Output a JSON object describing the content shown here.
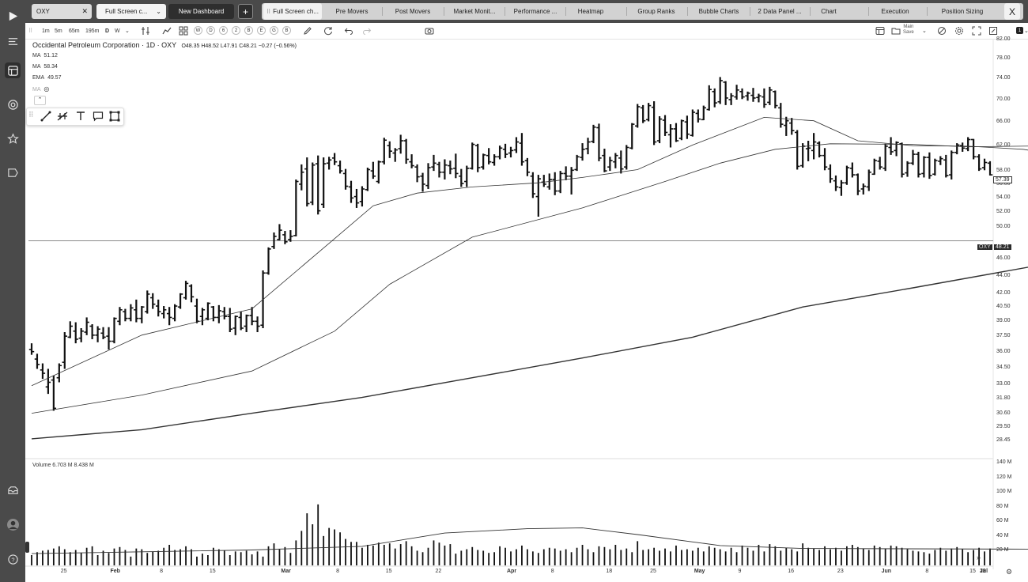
{
  "sidebar": {
    "icons": [
      "play-logo-icon",
      "menu-icon",
      "layout-icon",
      "target-icon",
      "star-icon",
      "screener-icon",
      "inbox-icon",
      "avatar",
      "help-icon"
    ]
  },
  "header": {
    "symbol_input": "OXY",
    "dashboard_tab": "Full Screen c...",
    "new_dashboard": "New Dashboard",
    "add_label": "+",
    "tabs": [
      "Full Screen ch...",
      "Pre Movers",
      "Post Movers",
      "Market Monit...",
      "Performance ...",
      "Heatmap",
      "Group Ranks",
      "Bubble Charts",
      "2 Data Panel ...",
      "Chart",
      "Execution",
      "Position Sizing"
    ],
    "close_label": "X"
  },
  "toolbar": {
    "intervals": [
      "1m",
      "5m",
      "65m",
      "195m",
      "D",
      "W"
    ],
    "circles": [
      "W",
      "D",
      "6",
      "2",
      "B",
      "E",
      "G",
      "B"
    ],
    "main_label": "Main",
    "save_label": "Save",
    "count_badge": "1"
  },
  "chart": {
    "title": "Occidental Petroleum Corporation · 1D · OXY",
    "ohlc": "O48.35  H48.52  L47.91  C48.21  −0.27  (−0.56%)",
    "indicators": [
      {
        "name": "MA",
        "value": "51.12"
      },
      {
        "name": "MA",
        "value": "58.34"
      },
      {
        "name": "EMA",
        "value": "49.57"
      },
      {
        "name": "MA",
        "value": ""
      }
    ],
    "volume_legend": "Volume  6.703 M  8.438 M",
    "price_ticks": [
      "82.00",
      "78.00",
      "74.00",
      "70.00",
      "66.00",
      "62.00",
      "58.00",
      "56.00",
      "54.00",
      "52.00",
      "50.00",
      "46.00",
      "44.00",
      "42.00",
      "40.50",
      "39.00",
      "37.50",
      "36.00",
      "34.50",
      "33.00",
      "31.80",
      "30.60",
      "29.50",
      "28.45"
    ],
    "volume_ticks": [
      "140 M",
      "120 M",
      "100 M",
      "80 M",
      "60 M",
      "40 M",
      "20 M"
    ],
    "time_labels": [
      "25",
      "Feb",
      "8",
      "15",
      "Mar",
      "8",
      "15",
      "22",
      "Apr",
      "8",
      "18",
      "25",
      "May",
      "9",
      "16",
      "23",
      "Jun",
      "8",
      "15",
      "23",
      "Jul",
      "11"
    ],
    "last_price": "57.39",
    "line_symbol": "OXY",
    "line_price": "48.21"
  },
  "chart_data": {
    "type": "ohlc",
    "title": "Occidental Petroleum Corporation · 1D · OXY",
    "y_scale": "log",
    "ylim": [
      28.45,
      82.0
    ],
    "x_range": [
      "Jan 18",
      "Jul 12"
    ],
    "candles": [
      [
        36.2,
        36.8,
        35.7,
        36.0
      ],
      [
        35.3,
        35.8,
        34.4,
        34.8
      ],
      [
        34.3,
        34.9,
        33.5,
        34.0
      ],
      [
        32.8,
        34.4,
        32.2,
        33.2
      ],
      [
        33.4,
        33.8,
        30.8,
        31.0
      ],
      [
        33.6,
        34.9,
        33.2,
        34.7
      ],
      [
        35.0,
        37.9,
        34.4,
        37.5
      ],
      [
        37.4,
        39.0,
        37.3,
        38.5
      ],
      [
        38.0,
        38.9,
        36.8,
        37.2
      ],
      [
        37.3,
        38.3,
        36.9,
        38.0
      ],
      [
        37.9,
        39.4,
        37.6,
        38.9
      ],
      [
        38.5,
        38.7,
        37.2,
        37.6
      ],
      [
        37.6,
        38.5,
        36.9,
        38.2
      ],
      [
        37.8,
        38.4,
        37.2,
        37.4
      ],
      [
        37.5,
        38.4,
        36.2,
        37.0
      ],
      [
        37.0,
        39.4,
        36.8,
        39.3
      ],
      [
        39.0,
        40.5,
        38.6,
        40.2
      ],
      [
        40.0,
        40.3,
        39.0,
        39.3
      ],
      [
        39.3,
        40.8,
        39.0,
        40.4
      ],
      [
        40.2,
        41.3,
        38.9,
        39.3
      ],
      [
        39.3,
        40.6,
        38.8,
        40.5
      ],
      [
        40.0,
        42.3,
        39.8,
        41.9
      ],
      [
        41.5,
        42.0,
        40.3,
        40.8
      ],
      [
        40.6,
        41.3,
        39.5,
        40.0
      ],
      [
        39.8,
        40.6,
        39.3,
        40.2
      ],
      [
        39.8,
        40.5,
        38.6,
        39.4
      ],
      [
        39.3,
        40.8,
        39.0,
        40.6
      ],
      [
        40.5,
        42.0,
        40.3,
        41.9
      ],
      [
        41.5,
        43.4,
        41.3,
        43.1
      ],
      [
        42.8,
        43.0,
        41.0,
        41.6
      ],
      [
        40.6,
        41.4,
        38.8,
        39.0
      ],
      [
        39.5,
        40.4,
        38.6,
        40.2
      ],
      [
        39.3,
        41.0,
        39.1,
        40.9
      ],
      [
        40.5,
        40.6,
        39.0,
        39.4
      ],
      [
        39.4,
        40.7,
        38.8,
        40.1
      ],
      [
        40.0,
        40.5,
        39.2,
        39.5
      ],
      [
        39.5,
        40.4,
        37.9,
        38.2
      ],
      [
        38.3,
        39.6,
        37.6,
        39.5
      ],
      [
        39.4,
        40.0,
        38.1,
        38.3
      ],
      [
        38.5,
        39.7,
        37.9,
        39.6
      ],
      [
        39.6,
        40.5,
        38.6,
        39.0
      ],
      [
        39.0,
        39.5,
        37.9,
        38.5
      ],
      [
        38.6,
        44.6,
        38.3,
        44.3
      ],
      [
        44.3,
        47.4,
        44.1,
        47.2
      ],
      [
        47.5,
        49.3,
        47.2,
        48.8
      ],
      [
        48.4,
        50.4,
        48.3,
        49.6
      ],
      [
        49.0,
        49.5,
        47.8,
        48.1
      ],
      [
        48.4,
        49.6,
        48.1,
        48.8
      ],
      [
        48.9,
        56.7,
        48.8,
        56.4
      ],
      [
        56.0,
        59.0,
        55.1,
        57.8
      ],
      [
        58.3,
        60.1,
        52.8,
        53.2
      ],
      [
        53.4,
        59.3,
        53.0,
        58.9
      ],
      [
        59.1,
        60.4,
        51.7,
        52.2
      ],
      [
        53.1,
        60.1,
        52.6,
        59.1
      ],
      [
        59.2,
        60.2,
        58.2,
        59.7
      ],
      [
        60.0,
        60.8,
        58.9,
        59.4
      ],
      [
        58.8,
        59.6,
        57.6,
        58.0
      ],
      [
        57.6,
        58.3,
        55.2,
        55.7
      ],
      [
        55.6,
        56.5,
        53.3,
        54.0
      ],
      [
        54.2,
        55.3,
        52.6,
        53.3
      ],
      [
        53.5,
        55.7,
        52.8,
        55.3
      ],
      [
        55.2,
        58.5,
        55.0,
        58.2
      ],
      [
        58.0,
        59.4,
        56.8,
        57.2
      ],
      [
        56.4,
        59.6,
        56.1,
        59.4
      ],
      [
        59.4,
        63.3,
        59.0,
        62.9
      ],
      [
        62.0,
        62.7,
        60.0,
        61.1
      ],
      [
        60.8,
        61.6,
        59.4,
        61.3
      ],
      [
        61.5,
        63.8,
        60.7,
        62.8
      ],
      [
        62.8,
        63.1,
        59.1,
        59.8
      ],
      [
        59.4,
        60.6,
        58.4,
        58.8
      ],
      [
        58.6,
        59.0,
        56.3,
        57.1
      ],
      [
        57.2,
        57.7,
        54.9,
        56.0
      ],
      [
        55.8,
        59.2,
        55.3,
        58.5
      ],
      [
        58.6,
        60.5,
        58.0,
        59.2
      ],
      [
        59.0,
        59.4,
        57.0,
        57.8
      ],
      [
        57.8,
        59.8,
        56.7,
        58.9
      ],
      [
        58.8,
        59.6,
        57.5,
        58.3
      ],
      [
        58.4,
        60.7,
        56.9,
        57.6
      ],
      [
        57.2,
        58.3,
        55.6,
        56.1
      ],
      [
        56.4,
        58.8,
        55.6,
        58.4
      ],
      [
        58.4,
        62.5,
        58.2,
        62.2
      ],
      [
        62.0,
        62.3,
        57.8,
        58.5
      ],
      [
        58.6,
        60.7,
        58.2,
        60.5
      ],
      [
        60.4,
        61.6,
        59.0,
        59.4
      ],
      [
        59.3,
        60.6,
        58.8,
        60.2
      ],
      [
        60.2,
        62.0,
        59.8,
        61.6
      ],
      [
        61.4,
        62.3,
        60.0,
        60.6
      ],
      [
        60.8,
        61.8,
        60.1,
        61.2
      ],
      [
        61.3,
        63.4,
        60.8,
        62.6
      ],
      [
        62.4,
        64.1,
        58.8,
        59.4
      ],
      [
        59.6,
        60.0,
        57.2,
        57.8
      ],
      [
        57.2,
        57.8,
        54.0,
        54.6
      ],
      [
        54.2,
        57.4,
        51.4,
        56.8
      ],
      [
        56.3,
        57.4,
        55.6,
        56.0
      ],
      [
        55.6,
        57.6,
        55.2,
        56.7
      ],
      [
        56.7,
        57.8,
        54.4,
        55.0
      ],
      [
        55.0,
        58.0,
        54.7,
        57.6
      ],
      [
        57.6,
        58.7,
        56.6,
        57.2
      ],
      [
        57.2,
        58.6,
        54.5,
        58.1
      ],
      [
        58.2,
        60.5,
        58.0,
        60.2
      ],
      [
        60.1,
        62.4,
        59.6,
        61.4
      ],
      [
        61.5,
        63.3,
        60.6,
        62.6
      ],
      [
        62.7,
        65.5,
        62.4,
        65.1
      ],
      [
        65.0,
        65.7,
        59.5,
        60.0
      ],
      [
        60.4,
        61.5,
        57.8,
        58.0
      ],
      [
        58.6,
        60.2,
        58.0,
        59.6
      ],
      [
        59.4,
        60.8,
        58.4,
        60.4
      ],
      [
        60.0,
        61.2,
        57.6,
        58.3
      ],
      [
        58.6,
        62.1,
        58.2,
        61.7
      ],
      [
        61.6,
        65.8,
        61.4,
        65.6
      ],
      [
        65.3,
        69.2,
        65.0,
        68.7
      ],
      [
        68.5,
        69.0,
        65.8,
        66.2
      ],
      [
        66.4,
        69.4,
        66.1,
        68.9
      ],
      [
        68.6,
        69.7,
        62.1,
        62.6
      ],
      [
        62.8,
        67.0,
        62.4,
        66.5
      ],
      [
        66.3,
        67.2,
        63.6,
        64.2
      ],
      [
        63.8,
        65.6,
        61.7,
        64.8
      ],
      [
        64.8,
        65.8,
        62.6,
        62.8
      ],
      [
        63.2,
        66.4,
        62.9,
        66.2
      ],
      [
        66.0,
        67.1,
        63.1,
        63.9
      ],
      [
        63.7,
        68.2,
        63.5,
        67.7
      ],
      [
        67.5,
        68.2,
        65.9,
        66.5
      ],
      [
        66.4,
        68.9,
        66.3,
        68.5
      ],
      [
        68.2,
        72.7,
        68.0,
        71.9
      ],
      [
        71.5,
        72.1,
        68.6,
        69.4
      ],
      [
        69.6,
        74.3,
        69.2,
        73.6
      ],
      [
        73.3,
        73.5,
        69.0,
        70.3
      ],
      [
        70.0,
        71.2,
        69.0,
        70.7
      ],
      [
        70.5,
        72.8,
        70.0,
        71.8
      ],
      [
        71.5,
        72.1,
        70.1,
        70.5
      ],
      [
        70.7,
        71.5,
        69.8,
        71.2
      ],
      [
        70.8,
        72.2,
        69.6,
        70.3
      ],
      [
        70.4,
        71.1,
        69.5,
        70.7
      ],
      [
        70.5,
        72.1,
        68.5,
        69.1
      ],
      [
        69.5,
        72.4,
        69.0,
        71.8
      ],
      [
        71.5,
        71.7,
        68.4,
        68.9
      ],
      [
        68.5,
        69.4,
        65.0,
        65.6
      ],
      [
        65.4,
        66.9,
        63.6,
        66.2
      ],
      [
        65.8,
        66.7,
        63.8,
        64.5
      ],
      [
        64.2,
        64.6,
        58.2,
        58.7
      ],
      [
        58.8,
        62.4,
        58.5,
        61.9
      ],
      [
        61.5,
        62.8,
        59.5,
        61.6
      ],
      [
        61.2,
        64.1,
        59.8,
        62.6
      ],
      [
        62.4,
        62.7,
        60.1,
        60.4
      ],
      [
        60.4,
        61.6,
        58.1,
        58.6
      ],
      [
        58.3,
        59.0,
        56.2,
        56.8
      ],
      [
        56.5,
        57.3,
        55.0,
        55.6
      ],
      [
        55.5,
        56.6,
        54.3,
        56.2
      ],
      [
        56.2,
        58.8,
        55.9,
        58.5
      ],
      [
        58.4,
        59.3,
        57.0,
        57.4
      ],
      [
        57.4,
        57.6,
        54.4,
        55.0
      ],
      [
        55.3,
        56.1,
        54.5,
        55.7
      ],
      [
        55.6,
        58.2,
        55.0,
        57.8
      ],
      [
        57.5,
        59.9,
        57.4,
        59.6
      ],
      [
        59.5,
        60.2,
        58.2,
        58.6
      ],
      [
        58.4,
        62.3,
        58.0,
        61.9
      ],
      [
        61.7,
        63.4,
        60.5,
        61.0
      ],
      [
        61.2,
        62.7,
        60.3,
        62.5
      ],
      [
        62.3,
        62.5,
        57.0,
        57.5
      ],
      [
        57.7,
        59.5,
        57.1,
        59.2
      ],
      [
        59.2,
        61.3,
        58.9,
        60.6
      ],
      [
        60.6,
        61.0,
        57.0,
        57.5
      ],
      [
        57.6,
        60.3,
        57.0,
        60.1
      ],
      [
        60.1,
        60.9,
        56.8,
        57.3
      ],
      [
        57.5,
        59.9,
        57.3,
        59.6
      ],
      [
        59.5,
        60.3,
        58.9,
        59.9
      ],
      [
        59.7,
        60.5,
        57.0,
        57.3
      ],
      [
        57.4,
        61.2,
        56.7,
        60.9
      ],
      [
        60.9,
        62.4,
        60.6,
        62.1
      ],
      [
        62.0,
        62.5,
        61.0,
        61.6
      ],
      [
        61.5,
        63.4,
        61.1,
        63.0
      ],
      [
        63.0,
        63.1,
        59.8,
        60.2
      ],
      [
        60.2,
        60.6,
        58.0,
        58.3
      ],
      [
        58.5,
        59.9,
        58.1,
        59.3
      ],
      [
        59.2,
        59.5,
        57.3,
        57.4
      ]
    ],
    "volume": [
      14,
      18,
      20,
      21,
      23,
      26,
      22,
      18,
      21,
      17,
      24,
      26,
      14,
      20,
      17,
      23,
      25,
      21,
      12,
      23,
      22,
      17,
      19,
      20,
      24,
      28,
      21,
      22,
      26,
      22,
      12,
      16,
      14,
      24,
      22,
      20,
      14,
      19,
      18,
      20,
      15,
      19,
      12,
      26,
      30,
      22,
      25,
      17,
      34,
      47,
      71,
      56,
      83,
      40,
      51,
      49,
      45,
      36,
      32,
      32,
      24,
      28,
      27,
      31,
      28,
      30,
      23,
      29,
      33,
      26,
      20,
      18,
      24,
      34,
      31,
      27,
      29,
      16,
      20,
      22,
      25,
      21,
      20,
      17,
      18,
      26,
      24,
      19,
      22,
      27,
      22,
      19,
      17,
      22,
      24,
      23,
      20,
      22,
      18,
      24,
      28,
      22,
      18,
      26,
      25,
      22,
      28,
      21,
      23,
      18,
      33,
      21,
      22,
      24,
      20,
      23,
      19,
      27,
      21,
      22,
      20,
      24,
      19,
      26,
      24,
      22,
      19,
      24,
      18,
      27,
      24,
      20,
      28,
      19,
      29,
      26,
      20,
      24,
      22,
      19,
      30,
      24,
      23,
      21,
      26,
      22,
      24,
      20,
      26,
      28,
      25,
      23,
      21,
      27,
      25,
      23,
      27,
      26,
      24,
      22,
      20,
      19,
      18,
      16,
      21,
      24,
      20,
      23,
      25,
      22,
      18,
      21,
      24,
      19,
      23,
      21,
      17,
      18,
      16,
      13,
      14,
      11,
      12,
      9,
      15
    ],
    "series": [
      {
        "name": "MA",
        "value": "51.12"
      },
      {
        "name": "MA",
        "value": "58.34"
      },
      {
        "name": "EMA",
        "value": "49.57"
      }
    ],
    "ma_short": [
      [
        0,
        32.9
      ],
      [
        20,
        37.6
      ],
      [
        40,
        40.3
      ],
      [
        55,
        48.5
      ],
      [
        62,
        52.9
      ],
      [
        70,
        54.7
      ],
      [
        80,
        55.6
      ],
      [
        92,
        56.2
      ],
      [
        100,
        57.0
      ],
      [
        110,
        58.2
      ],
      [
        120,
        62.1
      ],
      [
        133,
        66.8
      ],
      [
        142,
        66.2
      ],
      [
        150,
        62.8
      ],
      [
        160,
        62.0
      ],
      [
        170,
        61.9
      ],
      [
        180,
        61.4
      ],
      [
        187,
        60.4
      ]
    ],
    "ma_long": [
      [
        0,
        30.6
      ],
      [
        20,
        32.1
      ],
      [
        40,
        34.2
      ],
      [
        55,
        38.0
      ],
      [
        65,
        43.0
      ],
      [
        80,
        48.7
      ],
      [
        100,
        52.6
      ],
      [
        115,
        56.4
      ],
      [
        125,
        59.2
      ],
      [
        135,
        61.4
      ],
      [
        145,
        62.3
      ],
      [
        160,
        62.2
      ],
      [
        170,
        61.8
      ],
      [
        187,
        62.0
      ]
    ],
    "ema": [
      [
        0,
        28.6
      ],
      [
        20,
        29.3
      ],
      [
        40,
        30.6
      ],
      [
        60,
        31.9
      ],
      [
        80,
        33.6
      ],
      [
        100,
        35.4
      ],
      [
        120,
        37.4
      ],
      [
        140,
        40.5
      ],
      [
        160,
        42.6
      ],
      [
        187,
        45.7
      ]
    ],
    "vol_ma": [
      [
        0,
        16
      ],
      [
        40,
        21
      ],
      [
        60,
        26
      ],
      [
        75,
        44
      ],
      [
        90,
        50
      ],
      [
        100,
        51
      ],
      [
        110,
        42
      ],
      [
        125,
        27
      ],
      [
        140,
        23
      ],
      [
        187,
        22
      ]
    ]
  }
}
